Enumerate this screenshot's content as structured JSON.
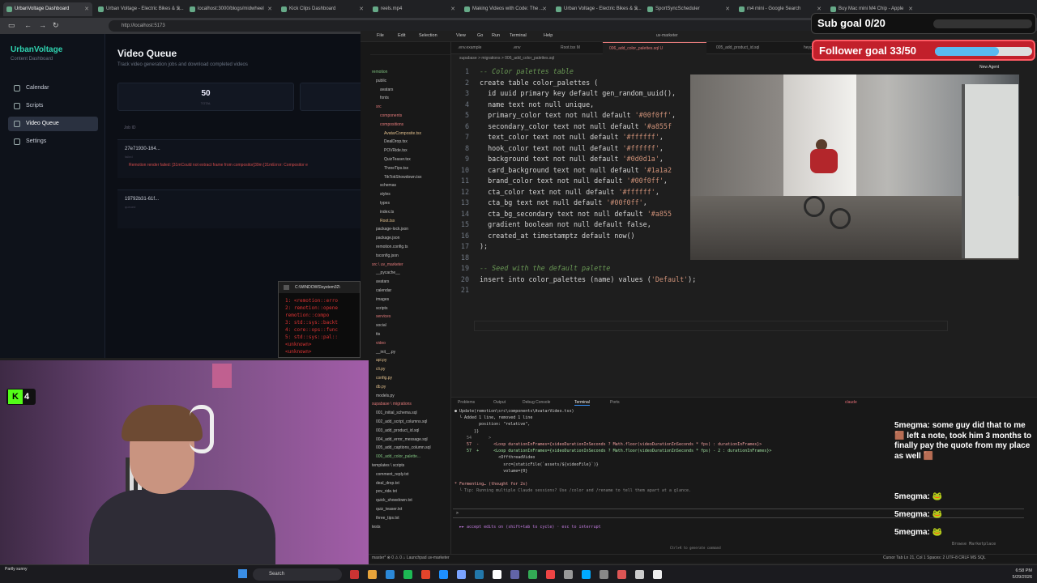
{
  "browser": {
    "tabs": [
      {
        "label": "UrbanVoltage Dashboard",
        "active": true
      },
      {
        "label": "Urban Voltage - Electric Bikes & S..."
      },
      {
        "label": "localhost:3000/blogs/midwheel"
      },
      {
        "label": "Kick Clips Dashboard"
      },
      {
        "label": "reels.mp4"
      },
      {
        "label": "Making Videos with Code: The ..."
      },
      {
        "label": "Urban Voltage - Electric Bikes & S..."
      },
      {
        "label": "SportSyncScheduler"
      },
      {
        "label": "m4 mini - Google Search"
      },
      {
        "label": "Buy Mac mini M4 Chip - Apple"
      }
    ],
    "url": "http://localhost:5173"
  },
  "webapp": {
    "brand": "UrbanVoltage",
    "brand_sub": "Content Dashboard",
    "nav": [
      {
        "label": "Calendar",
        "icon": "calendar-icon"
      },
      {
        "label": "Scripts",
        "icon": "scripts-icon"
      },
      {
        "label": "Video Queue",
        "icon": "video-icon",
        "active": true
      },
      {
        "label": "Settings",
        "icon": "gear-icon"
      }
    ],
    "title": "Video Queue",
    "subtitle": "Track video generation jobs and download completed videos",
    "stats": [
      {
        "value": "50",
        "label": "TOTAL"
      },
      {
        "value": "",
        "label": ""
      }
    ],
    "jobs_header": "Job ID",
    "jobs": [
      {
        "id": "27e71930-164...",
        "status": "failed",
        "error": "Remotion render failed: [31mCould not extract frame from compositor[39m [31mError: Compositor e"
      },
      {
        "id": "19792b31-61f...",
        "status": "queued",
        "error": ""
      }
    ]
  },
  "cmd": {
    "title": "C:\\WINDOWS\\system32\\",
    "lines": [
      "1: <remotion::erro",
      "2: remotion::opene",
      "   remotion::compo",
      "3: std::sys::backt",
      "4: core::ops::func",
      "5: std::sys::pal::",
      "   <unknown>",
      "   <unknown>"
    ]
  },
  "vscode": {
    "menus": [
      "File",
      "Edit",
      "Selection",
      "View",
      "Go",
      "Run",
      "Terminal",
      "Help"
    ],
    "project": "uv-marketer",
    "tabs": [
      ".env.example",
      ".env",
      "Root.tsx M",
      "006_add_color_palettes.sql U",
      "005_add_product_id.sql",
      "heygen_4bitsn"
    ],
    "active_tab": 3,
    "breadcrumb": "supabase > migrations > 006_add_color_palettes.sql",
    "explorer_root": "UV-MARKETER",
    "explorer": [
      {
        "name": "remotion",
        "c": "g",
        "d": 0
      },
      {
        "name": "public",
        "c": "",
        "d": 1
      },
      {
        "name": "avatars",
        "c": "",
        "d": 2
      },
      {
        "name": "fonts",
        "c": "",
        "d": 2
      },
      {
        "name": "src",
        "c": "r",
        "d": 1
      },
      {
        "name": "components",
        "c": "r",
        "d": 2
      },
      {
        "name": "compositions",
        "c": "r",
        "d": 2
      },
      {
        "name": "AvatarComposite.tsx",
        "c": "m",
        "d": 3
      },
      {
        "name": "DealDrop.tsx",
        "c": "",
        "d": 3
      },
      {
        "name": "POVRide.tsx",
        "c": "",
        "d": 3
      },
      {
        "name": "QuizTeaser.tsx",
        "c": "",
        "d": 3
      },
      {
        "name": "ThreeTips.tsx",
        "c": "",
        "d": 3
      },
      {
        "name": "TikTokShowdown.tsx",
        "c": "",
        "d": 3
      },
      {
        "name": "schemas",
        "c": "",
        "d": 2
      },
      {
        "name": "styles",
        "c": "",
        "d": 2
      },
      {
        "name": "types",
        "c": "",
        "d": 2
      },
      {
        "name": "index.ts",
        "c": "",
        "d": 2
      },
      {
        "name": "Root.tsx",
        "c": "m",
        "d": 2
      },
      {
        "name": "package-lock.json",
        "c": "",
        "d": 1
      },
      {
        "name": "package.json",
        "c": "",
        "d": 1
      },
      {
        "name": "remotion.config.ts",
        "c": "",
        "d": 1
      },
      {
        "name": "tsconfig.json",
        "c": "",
        "d": 1
      },
      {
        "name": "src \\ uv_marketer",
        "c": "r",
        "d": 0
      },
      {
        "name": "__pycache__",
        "c": "",
        "d": 1
      },
      {
        "name": "avatars",
        "c": "",
        "d": 1
      },
      {
        "name": "calendar",
        "c": "",
        "d": 1
      },
      {
        "name": "images",
        "c": "",
        "d": 1
      },
      {
        "name": "scripts",
        "c": "",
        "d": 1
      },
      {
        "name": "services",
        "c": "r",
        "d": 1
      },
      {
        "name": "social",
        "c": "",
        "d": 1
      },
      {
        "name": "tts",
        "c": "",
        "d": 1
      },
      {
        "name": "video",
        "c": "r",
        "d": 1
      },
      {
        "name": "__init__.py",
        "c": "",
        "d": 1
      },
      {
        "name": "api.py",
        "c": "m",
        "d": 1
      },
      {
        "name": "cli.py",
        "c": "m",
        "d": 1
      },
      {
        "name": "config.py",
        "c": "m",
        "d": 1
      },
      {
        "name": "db.py",
        "c": "m",
        "d": 1
      },
      {
        "name": "models.py",
        "c": "",
        "d": 1
      },
      {
        "name": "supabase \\ migrations",
        "c": "r",
        "d": 0
      },
      {
        "name": "001_initial_schema.sql",
        "c": "",
        "d": 1
      },
      {
        "name": "002_add_script_columns.sql",
        "c": "",
        "d": 1
      },
      {
        "name": "003_add_product_id.sql",
        "c": "",
        "d": 1
      },
      {
        "name": "004_add_error_message.sql",
        "c": "",
        "d": 1
      },
      {
        "name": "005_add_captions_column.sql",
        "c": "",
        "d": 1
      },
      {
        "name": "006_add_color_palette...",
        "c": "g",
        "d": 1
      },
      {
        "name": "templates \\ scripts",
        "c": "",
        "d": 0
      },
      {
        "name": "comment_reply.txt",
        "c": "",
        "d": 1
      },
      {
        "name": "deal_drop.txt",
        "c": "",
        "d": 1
      },
      {
        "name": "pov_ride.txt",
        "c": "",
        "d": 1
      },
      {
        "name": "quick_showdown.txt",
        "c": "",
        "d": 1
      },
      {
        "name": "quiz_teaser.txt",
        "c": "",
        "d": 1
      },
      {
        "name": "three_tips.txt",
        "c": "",
        "d": 1
      },
      {
        "name": "tests",
        "c": "",
        "d": 0
      }
    ],
    "code": [
      "-- Color palettes table",
      "create table color_palettes (",
      "  id uuid primary key default gen_random_uuid(),",
      "  name text not null unique,",
      "  primary_color text not null default '#00f0ff',",
      "  secondary_color text not null default '#a855f",
      "  text_color text not null default '#ffffff',",
      "  hook_color text not null default '#ffffff',",
      "  background text not null default '#0d0d1a',",
      "  card_background text not null default '#1a1a2",
      "  brand_color text not null default '#00f0ff',",
      "  cta_color text not null default '#ffffff',",
      "  cta_bg text not null default '#00f0ff',",
      "  cta_bg_secondary text not null default '#a855",
      "  gradient boolean not null default false,",
      "  created_at timestamptz default now()",
      ");",
      "",
      "-- Seed with the default palette",
      "insert into color_palettes (name) values ('Default');",
      ""
    ],
    "panel_tabs": [
      "Problems",
      "Output",
      "Debug Console",
      "Terminal",
      "Ports"
    ],
    "panel_active": 3,
    "terminal_label": "claude",
    "terminal": [
      {
        "t": "● Update(remotion\\src\\components\\AvatarVideo.tsx)",
        "c": "",
        "x": 0
      },
      {
        "t": "  └ Added 1 line, removed 1 line",
        "c": "",
        "x": 0
      },
      {
        "t": "          position: \"relative\",",
        "c": "",
        "x": 0
      },
      {
        "t": "        }}",
        "c": "",
        "x": 0
      },
      {
        "t": "     54       >",
        "c": "dim",
        "x": 0
      },
      {
        "t": "     57  -      <Loop durationInFrames={videoDurationInSeconds ? Math.floor(videoDurationInSeconds * fps) : durationInFrames}>",
        "c": "red",
        "x": 0
      },
      {
        "t": "     57  +      <Loop durationInFrames={videoDurationInSeconds ? Math.floor(videoDurationInSeconds * fps) - 2 : durationInFrames}>",
        "c": "grn",
        "x": 0
      },
      {
        "t": "                  <OffthreadVideo",
        "c": "",
        "x": 0
      },
      {
        "t": "                    src={staticFile(`assets/${videoFile}`)}",
        "c": "",
        "x": 0
      },
      {
        "t": "                    volume={0}",
        "c": "",
        "x": 0
      },
      {
        "t": "",
        "c": "",
        "x": 0
      },
      {
        "t": "* Fermenting… (thought for 2s)",
        "c": "red",
        "x": 0
      },
      {
        "t": "  └ Tip: Running multiple Claude sessions? Use /color and /rename to tell them apart at a glance.",
        "c": "dim",
        "x": 0
      }
    ],
    "prompt": ">",
    "accept_edits": "►► accept edits on (shift+tab to cycle) · esc to interrupt",
    "hint": "Ctrl+K to generate command",
    "status": {
      "left": "master*   ⊗ 0 ⚠ 0   ⌂ Launchpad   uv-marketer",
      "right": "Cursor Tab   Ln 21, Col 1   Spaces: 2   UTF-8   CRLF   MS SQL"
    },
    "browse_marketplace": "Browse Marketplace",
    "window_title": "uv-marketer",
    "new_agent": "New Agent"
  },
  "overlay": {
    "sub_goal": "Sub goal 0/20",
    "sub_progress": 0,
    "follower_goal": "Follower goal 33/50",
    "follower_progress": 0.66
  },
  "cam": {
    "kick_count": "4"
  },
  "chat": [
    {
      "user": "5megma:",
      "text": "some guy did that to me 🟫 left a note, took him 3 months to finally pay the quote from my place as well 🟫"
    },
    {
      "user": "5megma:",
      "text": "🐸"
    },
    {
      "user": "5megma:",
      "text": "🐸"
    },
    {
      "user": "5megma:",
      "text": "🐸"
    }
  ],
  "taskbar": {
    "search": "Search",
    "weather": "Partly sunny",
    "time": "6:58 PM",
    "date": "5/29/2026"
  },
  "colors": {
    "brand": "#2fd3b0",
    "error": "#d34b4b",
    "follower_bar": "#5ab9f0",
    "follower_bg": "#c2202b",
    "active_tab": "#e37a7a"
  }
}
